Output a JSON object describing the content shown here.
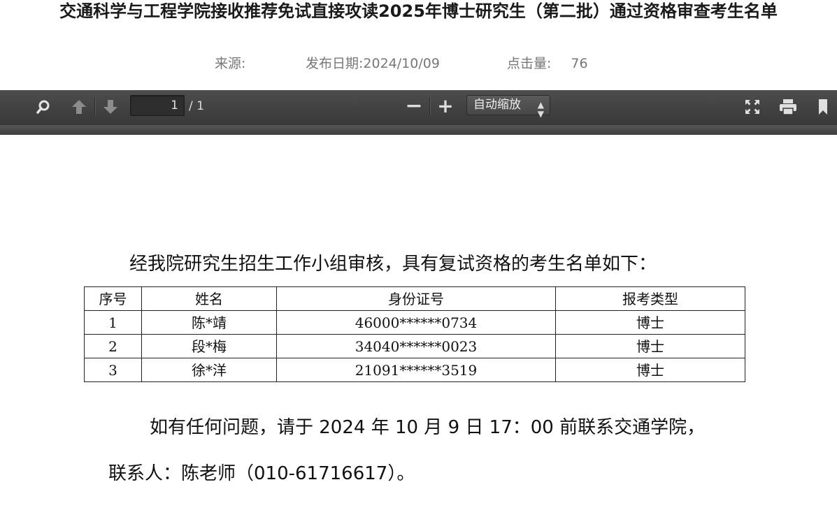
{
  "article": {
    "title": "交通科学与工程学院接收推荐免试直接攻读2025年博士研究生（第二批）通过资格审查考生名单",
    "meta": {
      "source_label": "来源:",
      "source_value": "",
      "date_label": "发布日期:",
      "date_value": "2024/10/09",
      "hits_label": "点击量:",
      "hits_value": "76"
    }
  },
  "viewer": {
    "toolbar": {
      "search_icon": "search-icon",
      "prev_icon": "arrow-up-icon",
      "next_icon": "arrow-down-icon",
      "page_current": "1",
      "page_total": "/ 1",
      "zoom_out": "−",
      "zoom_in": "+",
      "zoom_value": "自动缩放",
      "fullscreen_icon": "fullscreen-icon",
      "print_icon": "printer-icon",
      "bookmark_icon": "bookmark-icon"
    }
  },
  "document": {
    "intro": "经我院研究生招生工作小组审核，具有复试资格的考生名单如下：",
    "table": {
      "headers": [
        "序号",
        "姓名",
        "身份证号",
        "报考类型"
      ],
      "rows": [
        [
          "1",
          "陈*靖",
          "46000******0734",
          "博士"
        ],
        [
          "2",
          "段*梅",
          "34040******0023",
          "博士"
        ],
        [
          "3",
          "徐*洋",
          "21091******3519",
          "博士"
        ]
      ]
    },
    "note_line1": "如有任何问题，请于 2024 年 10 月 9 日 17：00 前联系交通学院，",
    "note_line2": "联系人：陈老师（010-61716617）。"
  }
}
